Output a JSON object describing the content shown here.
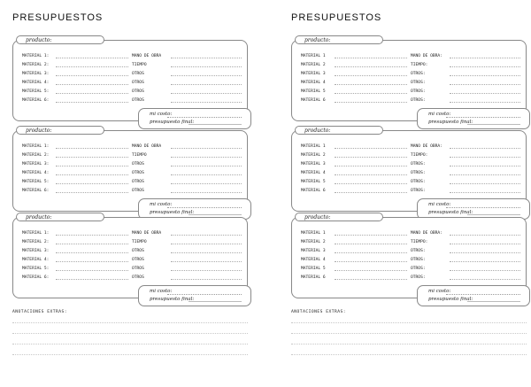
{
  "pages": [
    {
      "title": "PRESUPUESTOS",
      "product_label": "producto:",
      "cost_label": "mi costo:",
      "final_label": "presupuesto final:",
      "notes_label": "ANOTACIONES EXTRAS:",
      "blocks": [
        {
          "rows": [
            {
              "left": "MATERIAL 1:",
              "right": "MANO DE OBRA"
            },
            {
              "left": "MATERIAL 2:",
              "right": "TIEMPO"
            },
            {
              "left": "MATERIAL 3:",
              "right": "OTROS"
            },
            {
              "left": "MATERIAL 4:",
              "right": "OTROS"
            },
            {
              "left": "MATERIAL 5:",
              "right": "OTROS"
            },
            {
              "left": "MATERIAL 6:",
              "right": "OTROS"
            }
          ]
        },
        {
          "rows": [
            {
              "left": "MATERIAL 1:",
              "right": "MANO DE OBRA"
            },
            {
              "left": "MATERIAL 2:",
              "right": "TIEMPO"
            },
            {
              "left": "MATERIAL 3:",
              "right": "OTROS"
            },
            {
              "left": "MATERIAL 4:",
              "right": "OTROS"
            },
            {
              "left": "MATERIAL 5:",
              "right": "OTROS"
            },
            {
              "left": "MATERIAL 6:",
              "right": "OTROS"
            }
          ]
        },
        {
          "rows": [
            {
              "left": "MATERIAL 1:",
              "right": "MANO DE OBRA"
            },
            {
              "left": "MATERIAL 2:",
              "right": "TIEMPO"
            },
            {
              "left": "MATERIAL 3:",
              "right": "OTROS"
            },
            {
              "left": "MATERIAL 4:",
              "right": "OTROS"
            },
            {
              "left": "MATERIAL 5:",
              "right": "OTROS"
            },
            {
              "left": "MATERIAL 6:",
              "right": "OTROS"
            }
          ]
        }
      ]
    },
    {
      "title": "PRESUPUESTOS",
      "product_label": "producto:",
      "cost_label": "mi costo:",
      "final_label": "presupuesto final:",
      "notes_label": "ANOTACIONES EXTRAS:",
      "blocks": [
        {
          "rows": [
            {
              "left": "MATERIAL 1",
              "right": "MANO DE OBRA:"
            },
            {
              "left": "MATERIAL 2",
              "right": "TIEMPO:"
            },
            {
              "left": "MATERIAL 3",
              "right": "OTROS:"
            },
            {
              "left": "MATERIAL 4",
              "right": "OTROS:"
            },
            {
              "left": "MATERIAL 5",
              "right": "OTROS:"
            },
            {
              "left": "MATERIAL 6",
              "right": "OTROS:"
            }
          ]
        },
        {
          "rows": [
            {
              "left": "MATERIAL 1",
              "right": "MANO DE OBRA:"
            },
            {
              "left": "MATERIAL 2",
              "right": "TIEMPO:"
            },
            {
              "left": "MATERIAL 3",
              "right": "OTROS:"
            },
            {
              "left": "MATERIAL 4",
              "right": "OTROS:"
            },
            {
              "left": "MATERIAL 5",
              "right": "OTROS:"
            },
            {
              "left": "MATERIAL 6",
              "right": "OTROS:"
            }
          ]
        },
        {
          "rows": [
            {
              "left": "MATERIAL 1",
              "right": "MANO DE OBRA:"
            },
            {
              "left": "MATERIAL 2",
              "right": "TIEMPO:"
            },
            {
              "left": "MATERIAL 3",
              "right": "OTROS:"
            },
            {
              "left": "MATERIAL 4",
              "right": "OTROS:"
            },
            {
              "left": "MATERIAL 5",
              "right": "OTROS:"
            },
            {
              "left": "MATERIAL 6",
              "right": "OTROS:"
            }
          ]
        }
      ]
    }
  ]
}
